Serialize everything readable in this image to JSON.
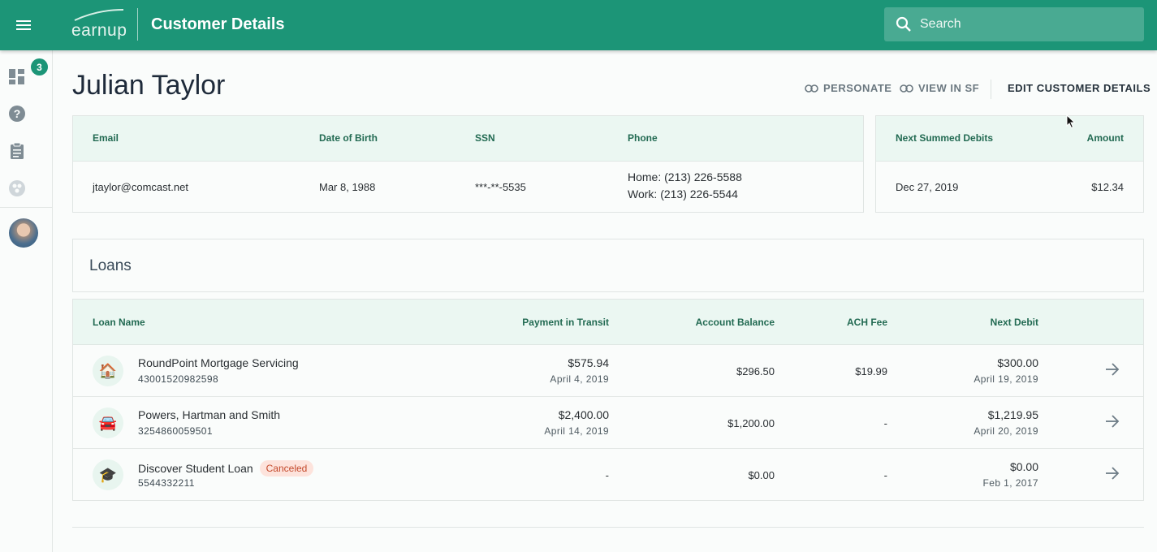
{
  "app": {
    "logo_text": "earnup",
    "title": "Customer Details",
    "search_placeholder": "Search"
  },
  "sidebar": {
    "badge_count": "3",
    "items": [
      {
        "icon": "dashboard-icon"
      },
      {
        "icon": "help-icon"
      },
      {
        "icon": "clipboard-icon"
      },
      {
        "icon": "group-icon"
      }
    ]
  },
  "customer": {
    "name": "Julian Taylor",
    "actions": {
      "personate": "PERSONATE",
      "view_sf": "VIEW IN SF",
      "edit": "EDIT CUSTOMER DETAILS"
    },
    "headers": {
      "email": "Email",
      "dob": "Date of Birth",
      "ssn": "SSN",
      "phone": "Phone"
    },
    "email": "jtaylor@comcast.net",
    "dob": "Mar 8, 1988",
    "ssn": "***-**-5535",
    "phone_home": "Home: (213) 226-5588",
    "phone_work": "Work: (213) 226-5544"
  },
  "debits": {
    "headers": {
      "next": "Next Summed Debits",
      "amount": "Amount"
    },
    "date": "Dec 27, 2019",
    "amount": "$12.34"
  },
  "loans": {
    "title": "Loans",
    "headers": {
      "name": "Loan Name",
      "transit": "Payment in Transit",
      "balance": "Account Balance",
      "fee": "ACH Fee",
      "next": "Next Debit"
    },
    "rows": [
      {
        "icon": "house-icon",
        "icon_glyph": "🏠",
        "name": "RoundPoint Mortgage Servicing",
        "number": "43001520982598",
        "status": "",
        "transit": "$575.94",
        "transit_date": "April 4, 2019",
        "balance": "$296.50",
        "fee": "$19.99",
        "next": "$300.00",
        "next_date": "April 19, 2019"
      },
      {
        "icon": "car-icon",
        "icon_glyph": "🚘",
        "name": "Powers, Hartman and Smith",
        "number": "3254860059501",
        "status": "",
        "transit": "$2,400.00",
        "transit_date": "April 14, 2019",
        "balance": "$1,200.00",
        "fee": "-",
        "next": "$1,219.95",
        "next_date": "April 20, 2019"
      },
      {
        "icon": "graduation-cap-icon",
        "icon_glyph": "🎓",
        "name": "Discover Student Loan",
        "number": "5544332211",
        "status": "Canceled",
        "transit": "-",
        "transit_date": "",
        "balance": "$0.00",
        "fee": "-",
        "next": "$0.00",
        "next_date": "Feb 1, 2017"
      }
    ]
  }
}
